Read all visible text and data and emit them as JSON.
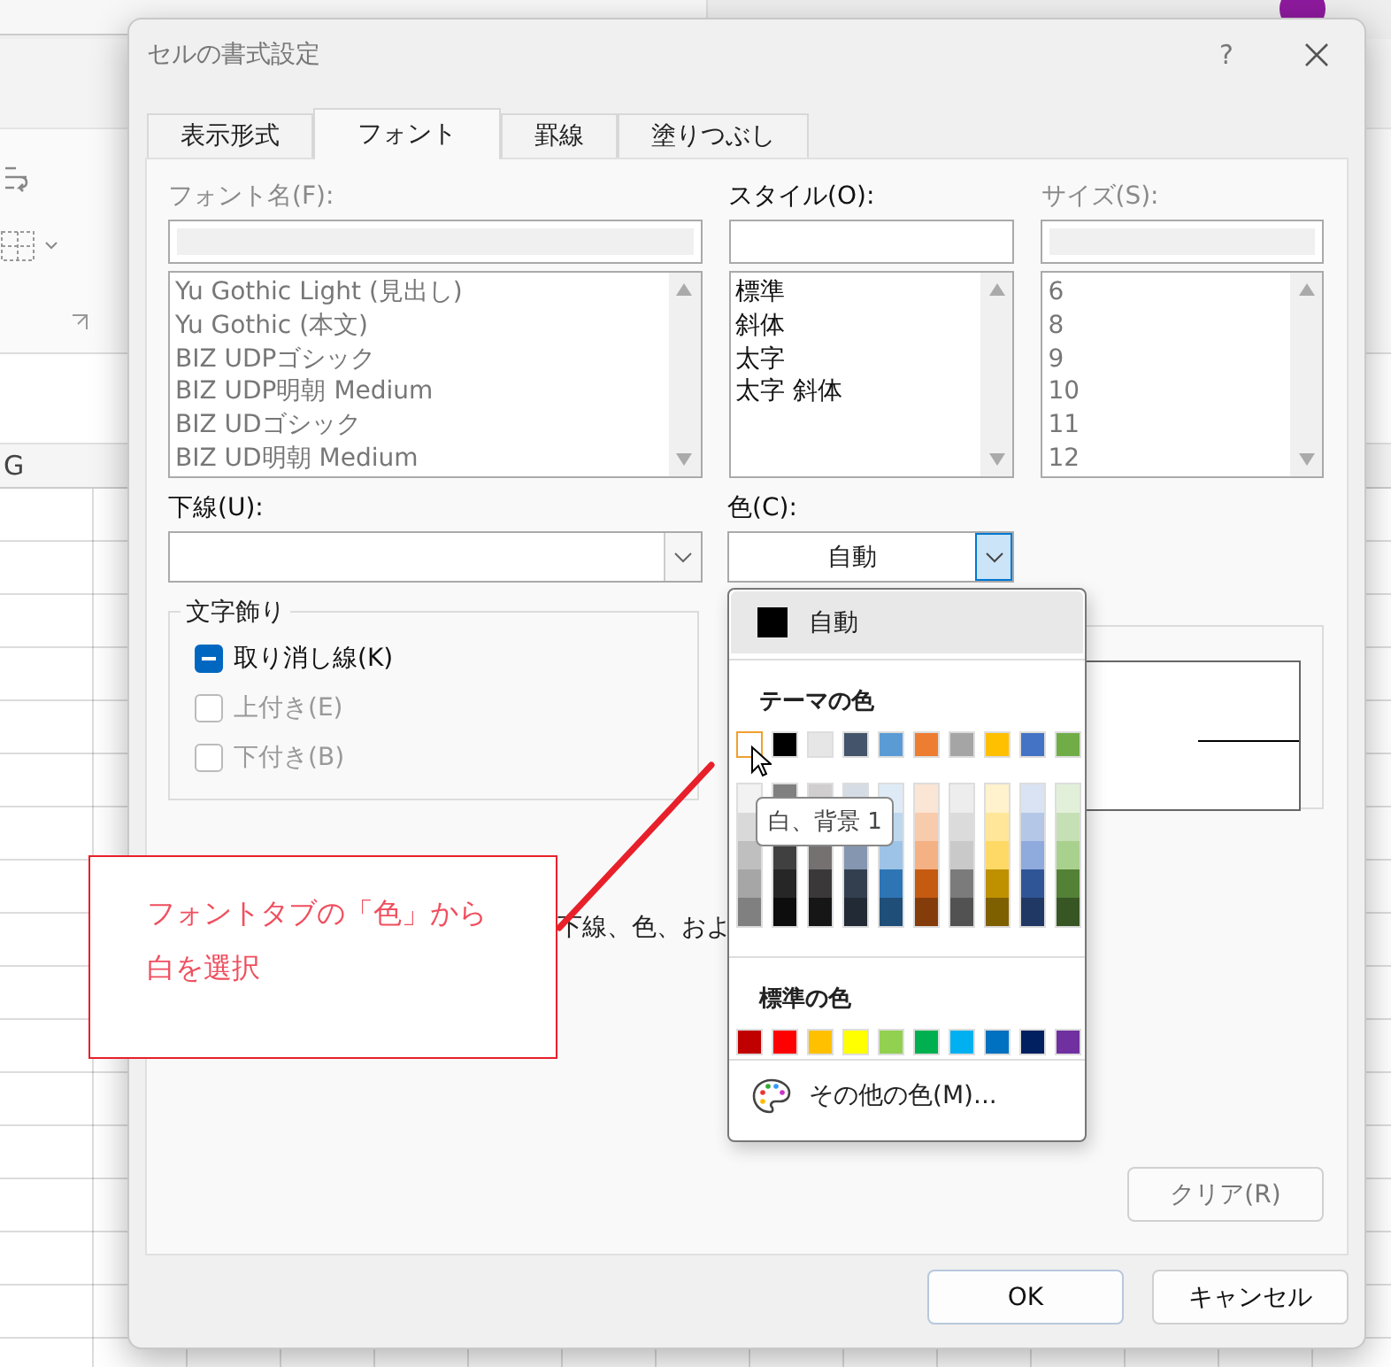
{
  "app": {
    "column_header": "G"
  },
  "dialog": {
    "title": "セルの書式設定",
    "help_button": "?",
    "tabs": [
      {
        "label": "表示形式",
        "selected": false
      },
      {
        "label": "フォント",
        "selected": true
      },
      {
        "label": "罫線",
        "selected": false
      },
      {
        "label": "塗りつぶし",
        "selected": false
      }
    ],
    "font_name": {
      "label": "フォント名(F):",
      "disabled": true,
      "items": [
        "Yu Gothic Light (見出し)",
        "Yu Gothic (本文)",
        "BIZ UDPゴシック",
        "BIZ UDP明朝 Medium",
        "BIZ UDゴシック",
        "BIZ UD明朝 Medium"
      ]
    },
    "style": {
      "label": "スタイル(O):",
      "disabled": false,
      "items": [
        "標準",
        "斜体",
        "太字",
        "太字 斜体"
      ]
    },
    "size": {
      "label": "サイズ(S):",
      "disabled": true,
      "items": [
        "6",
        "8",
        "9",
        "10",
        "11",
        "12"
      ]
    },
    "underline": {
      "label": "下線(U):"
    },
    "color": {
      "label": "色(C):",
      "value": "自動",
      "open": true
    },
    "effects": {
      "title": "文字飾り",
      "options": [
        {
          "label": "取り消し線(K)",
          "indeterminate": true,
          "disabled": false
        },
        {
          "label": "上付き(E)",
          "indeterminate": false,
          "disabled": true
        },
        {
          "label": "下付き(B)",
          "indeterminate": false,
          "disabled": true
        }
      ]
    },
    "description_fragment": "下線、色、およ",
    "clear_button": "クリア(R)",
    "buttons": [
      "OK",
      "キャンセル"
    ]
  },
  "color_menu": {
    "automatic": {
      "label": "自動",
      "color": "#000000"
    },
    "theme_title": "テーマの色",
    "theme_colors": [
      {
        "color": "#ffffff",
        "selected": true
      },
      {
        "color": "#000000",
        "selected": false
      },
      {
        "color": "#e7e6e6",
        "selected": false
      },
      {
        "color": "#44546a",
        "selected": false
      },
      {
        "color": "#5b9bd5",
        "selected": false
      },
      {
        "color": "#ed7d31",
        "selected": false
      },
      {
        "color": "#a5a5a5",
        "selected": false
      },
      {
        "color": "#ffc000",
        "selected": false
      },
      {
        "color": "#4472c4",
        "selected": false
      },
      {
        "color": "#70ad47",
        "selected": false
      }
    ],
    "shade_columns": [
      {
        "shades": [
          {
            "color": "#f2f2f2"
          },
          {
            "color": "#d9d9d9"
          },
          {
            "color": "#bfbfbf"
          },
          {
            "color": "#a6a6a6"
          },
          {
            "color": "#808080"
          }
        ]
      },
      {
        "shades": [
          {
            "color": "#808080"
          },
          {
            "color": "#404040"
          },
          {
            "color": "#262626"
          },
          {
            "color": "#0d0d0d"
          }
        ]
      },
      {
        "shades": [
          {
            "color": "#d0cece"
          },
          {
            "color": "#757171"
          },
          {
            "color": "#3a3838"
          },
          {
            "color": "#171616"
          }
        ]
      },
      {
        "shades": [
          {
            "color": "#d6dce4"
          },
          {
            "color": "#8496b0"
          },
          {
            "color": "#333f4f"
          },
          {
            "color": "#222a35"
          }
        ]
      },
      {
        "shades": [
          {
            "color": "#deebf6"
          },
          {
            "color": "#bdd7ee"
          },
          {
            "color": "#9dc3e6"
          },
          {
            "color": "#2e75b5"
          },
          {
            "color": "#1f4e79"
          }
        ]
      },
      {
        "shades": [
          {
            "color": "#fbe5d5"
          },
          {
            "color": "#f8cbad"
          },
          {
            "color": "#f4b183"
          },
          {
            "color": "#c55a11"
          },
          {
            "color": "#843c0b"
          }
        ]
      },
      {
        "shades": [
          {
            "color": "#ededed"
          },
          {
            "color": "#dbdbdb"
          },
          {
            "color": "#c9c9c9"
          },
          {
            "color": "#7b7b7b"
          },
          {
            "color": "#525252"
          }
        ]
      },
      {
        "shades": [
          {
            "color": "#fff2cc"
          },
          {
            "color": "#ffe699"
          },
          {
            "color": "#ffd966"
          },
          {
            "color": "#bf9000"
          },
          {
            "color": "#7f6000"
          }
        ]
      },
      {
        "shades": [
          {
            "color": "#dae3f3"
          },
          {
            "color": "#b4c7e7"
          },
          {
            "color": "#8faadc"
          },
          {
            "color": "#2f5597"
          },
          {
            "color": "#203864"
          }
        ]
      },
      {
        "shades": [
          {
            "color": "#e2f0d9"
          },
          {
            "color": "#c5e0b4"
          },
          {
            "color": "#a9d18e"
          },
          {
            "color": "#538135"
          },
          {
            "color": "#375623"
          }
        ]
      }
    ],
    "tooltip": "白、背景 1",
    "standard_title": "標準の色",
    "standard_colors": [
      {
        "color": "#c00000"
      },
      {
        "color": "#ff0000"
      },
      {
        "color": "#ffc000"
      },
      {
        "color": "#ffff00"
      },
      {
        "color": "#92d050"
      },
      {
        "color": "#00b050"
      },
      {
        "color": "#00b0f0"
      },
      {
        "color": "#0070c0"
      },
      {
        "color": "#002060"
      },
      {
        "color": "#7030a0"
      }
    ],
    "more_colors": "その他の色(M)..."
  },
  "annotation": {
    "lines": [
      "フォントタブの「色」から",
      "白を選択"
    ]
  }
}
